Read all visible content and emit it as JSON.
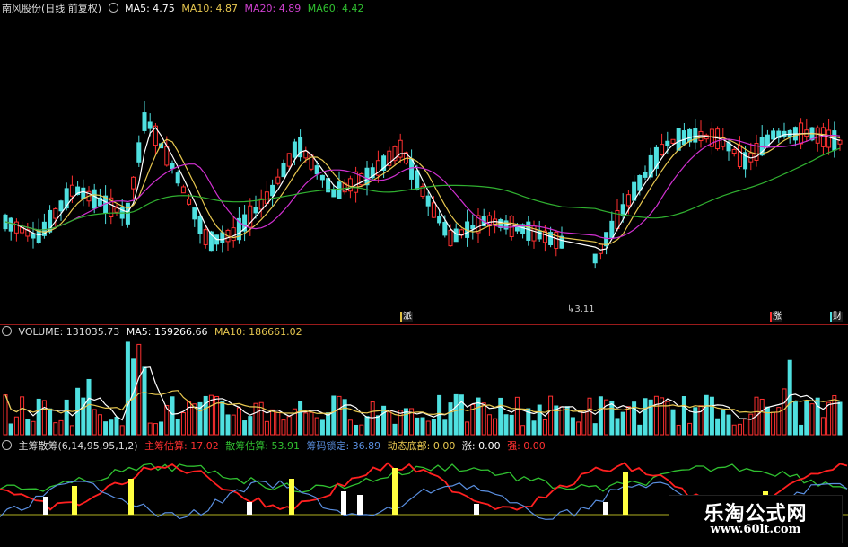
{
  "price_header": {
    "title": "南风股份(日线 前复权)",
    "ma5": "MA5: 4.75",
    "ma10": "MA10: 4.87",
    "ma20": "MA20: 4.89",
    "ma60": "MA60: 4.42"
  },
  "price_panel": {
    "low_marker": "3.11",
    "tags": {
      "t1": "派",
      "t2": "涨",
      "t3": "财"
    }
  },
  "volume_header": {
    "volume": "VOLUME: 131035.73",
    "ma5": "MA5: 159266.66",
    "ma10": "MA10: 186661.02"
  },
  "indicator_header": {
    "name": "主筹散筹(6,14,95,95,1,2)",
    "main": "主筹估算: 17.02",
    "scatter": "散筹估算: 53.91",
    "locked": "筹码锁定: 36.89",
    "bottom": "动态底部: 0.00",
    "rise": "涨: 0.00",
    "strong": "强: 0.00"
  },
  "watermark": {
    "title": "乐淘公式网",
    "url": "www.60lt.com"
  },
  "colors": {
    "up": "#ff3030",
    "down": "#4fe0e0",
    "ma5": "#ffffff",
    "ma10": "#e8c850",
    "ma20": "#d030d0",
    "ma60": "#30b030",
    "bar_white": "#ffffff",
    "bar_yellow": "#ffff40",
    "line_red": "#ff2020",
    "line_green": "#30c030",
    "line_blue": "#5a8fe0"
  }
}
